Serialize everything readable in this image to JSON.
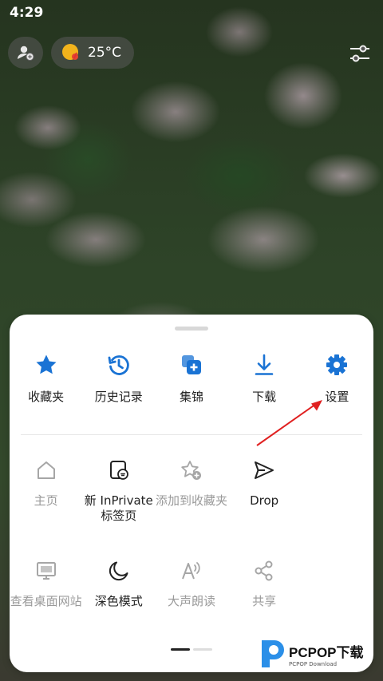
{
  "status": {
    "time": "4:29"
  },
  "topbar": {
    "temperature": "25°C"
  },
  "sheet": {
    "row1": [
      {
        "label": "收藏夹",
        "icon": "star-icon"
      },
      {
        "label": "历史记录",
        "icon": "history-icon"
      },
      {
        "label": "集锦",
        "icon": "collections-icon"
      },
      {
        "label": "下载",
        "icon": "download-icon"
      },
      {
        "label": "设置",
        "icon": "gear-icon"
      }
    ],
    "row2": [
      {
        "label": "主页",
        "icon": "home-icon",
        "enabled": false
      },
      {
        "label": "新 InPrivate 标签页",
        "line1": "新 InPrivate",
        "line2": "标签页",
        "icon": "inprivate-icon",
        "enabled": true
      },
      {
        "label": "添加到收藏夹",
        "icon": "add-favorite-icon",
        "enabled": false
      },
      {
        "label": "Drop",
        "icon": "send-icon",
        "enabled": true
      }
    ],
    "row3": [
      {
        "label": "查看桌面网站",
        "icon": "desktop-icon",
        "enabled": false
      },
      {
        "label": "深色模式",
        "icon": "moon-icon",
        "enabled": true
      },
      {
        "label": "大声朗读",
        "icon": "read-aloud-icon",
        "enabled": false
      },
      {
        "label": "共享",
        "icon": "share-icon",
        "enabled": false
      }
    ],
    "pager": {
      "current": 1,
      "total": 2
    }
  },
  "watermark": {
    "text": "PCPOP下载",
    "sub": "PCPOP Download"
  },
  "colors": {
    "accent": "#1a73d4",
    "disabled": "#9a9a9a",
    "annotation": "#e02020"
  }
}
